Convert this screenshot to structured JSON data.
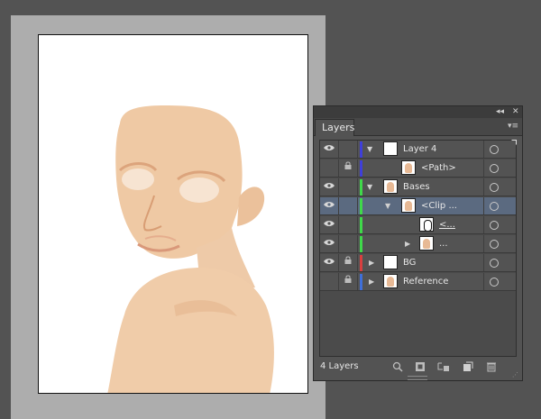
{
  "panel": {
    "title": "Layers",
    "collapse_glyph": "◂◂",
    "close_glyph": "✕",
    "menu_glyph": "▾≡",
    "layer_count": "4 Layers"
  },
  "colors": {
    "layer4": "#3f3fd9",
    "bases": "#3fd94a",
    "bg": "#d93f3f",
    "reference": "#3f6fd9",
    "skin": "#eecaa8",
    "skin_shadow": "#e0ad86",
    "selected_row": "#5b6a80"
  },
  "layers": [
    {
      "label": "Layer 4",
      "visible": true,
      "locked": false,
      "expanded": true
    },
    {
      "label": "<Path>",
      "visible": false,
      "locked": true
    },
    {
      "label": "Bases",
      "visible": true,
      "locked": false,
      "expanded": true
    },
    {
      "label": "<Clip ...",
      "visible": true,
      "locked": false,
      "expanded": true,
      "selected": true
    },
    {
      "label": "<...",
      "visible": true,
      "locked": false
    },
    {
      "label": "...",
      "visible": true,
      "locked": false,
      "expanded": false
    },
    {
      "label": "BG",
      "visible": true,
      "locked": true,
      "expanded": false
    },
    {
      "label": "Reference",
      "visible": false,
      "locked": true,
      "expanded": false
    }
  ],
  "icons": {
    "eye": "eye-icon",
    "lock": "lock-icon",
    "expand": "triangle-down-icon",
    "collapse": "triangle-right-icon",
    "target": "target-circle-icon",
    "footer": [
      "locate-object-icon",
      "make-clipping-mask-icon",
      "create-sublayer-icon",
      "new-layer-icon",
      "delete-icon"
    ]
  }
}
